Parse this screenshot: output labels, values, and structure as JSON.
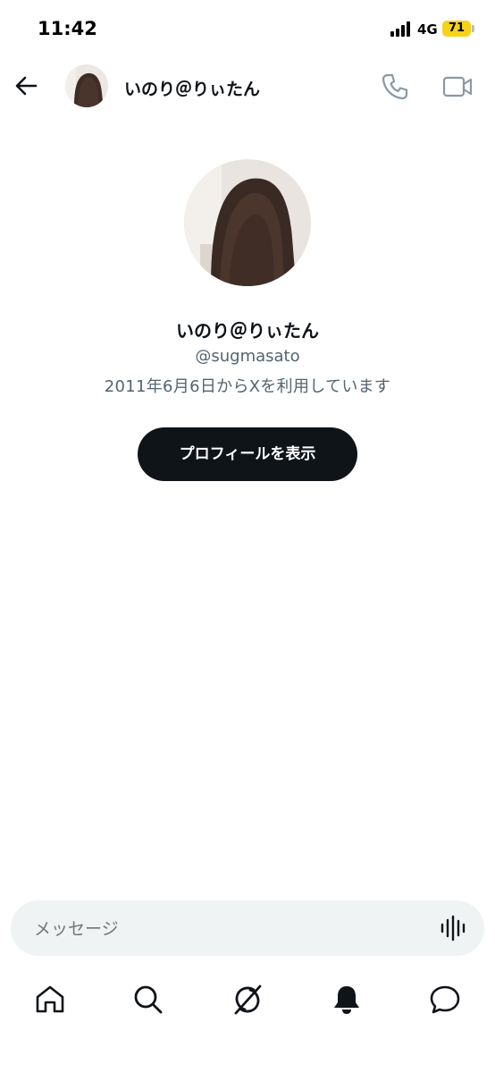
{
  "status_bar": {
    "time": "11:42",
    "network": "4G",
    "battery": "71",
    "battery_color": "#f7d21b"
  },
  "header": {
    "back_icon": "arrow-left-icon",
    "name": "いのり＠りぃたん",
    "call_icon": "phone-icon",
    "video_icon": "video-camera-icon"
  },
  "profile": {
    "name": "いのり＠りぃたん",
    "handle": "@sugmasato",
    "joined": "2011年6月6日からXを利用しています",
    "view_profile_label": "プロフィールを表示"
  },
  "composer": {
    "placeholder": "メッセージ",
    "voice_icon": "voice-waveform-icon"
  },
  "bottom_nav": {
    "items": [
      {
        "icon": "home-icon"
      },
      {
        "icon": "search-icon"
      },
      {
        "icon": "grok-icon"
      },
      {
        "icon": "bell-icon"
      },
      {
        "icon": "messages-icon"
      }
    ]
  },
  "colors": {
    "text_primary": "#0f1419",
    "text_secondary": "#536471",
    "button_bg": "#0f1419",
    "input_bg": "#eff3f4"
  }
}
